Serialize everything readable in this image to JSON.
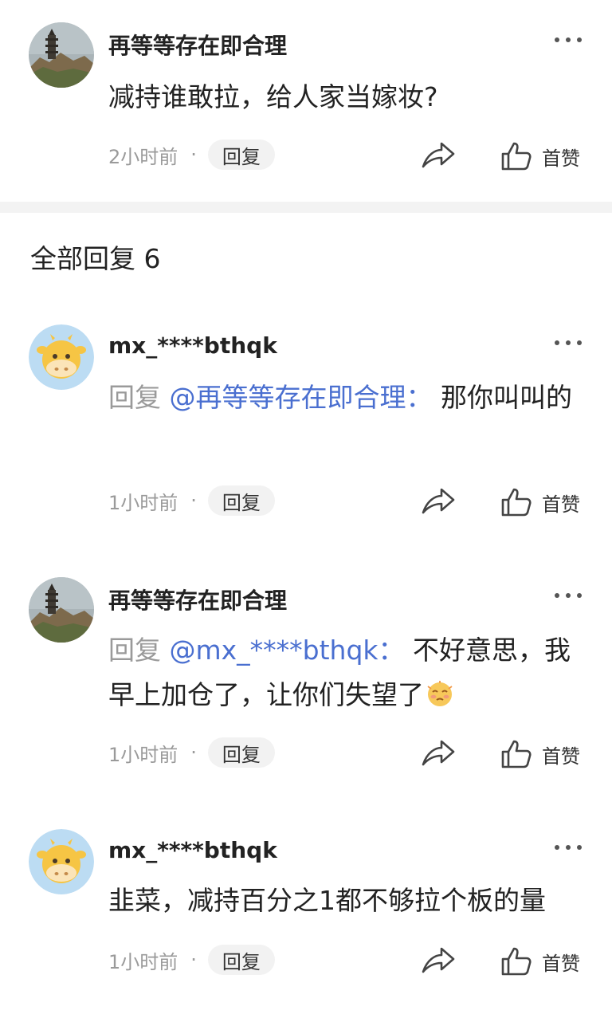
{
  "main_comment": {
    "username": "再等等存在即合理",
    "text": "减持谁敢拉，给人家当嫁妆?",
    "time": "2小时前",
    "dot": "·",
    "reply_label": "回复",
    "like_label": "首赞"
  },
  "replies_header": {
    "title": "全部回复 6"
  },
  "replies": [
    {
      "username": "mx_****bthqk",
      "reply_prefix": "回复 ",
      "mention": "@再等等存在即合理：",
      "text": " 那你叫叫的",
      "time": "1小时前",
      "dot": "·",
      "reply_label": "回复",
      "like_label": "首赞"
    },
    {
      "username": "再等等存在即合理",
      "reply_prefix": "回复 ",
      "mention": "@mx_****bthqk：",
      "text": " 不好意思，我早上加仓了，让你们失望了",
      "time": "1小时前",
      "dot": "·",
      "reply_label": "回复",
      "like_label": "首赞"
    },
    {
      "username": "mx_****bthqk",
      "text": "韭菜，减持百分之1都不够拉个板的量",
      "time": "1小时前",
      "dot": "·",
      "reply_label": "回复",
      "like_label": "首赞"
    }
  ],
  "icons": {
    "more": "more-dots-icon",
    "share": "share-arrow-icon",
    "like": "thumbs-up-icon",
    "emoji": "embarrassed-face-emoji-icon",
    "avatar_tower": "tower-landscape-avatar",
    "avatar_cow": "cow-cartoon-avatar"
  },
  "colors": {
    "mention": "#4a6fd0",
    "muted": "#9a9a9a",
    "divider": "#f3f3f3"
  }
}
